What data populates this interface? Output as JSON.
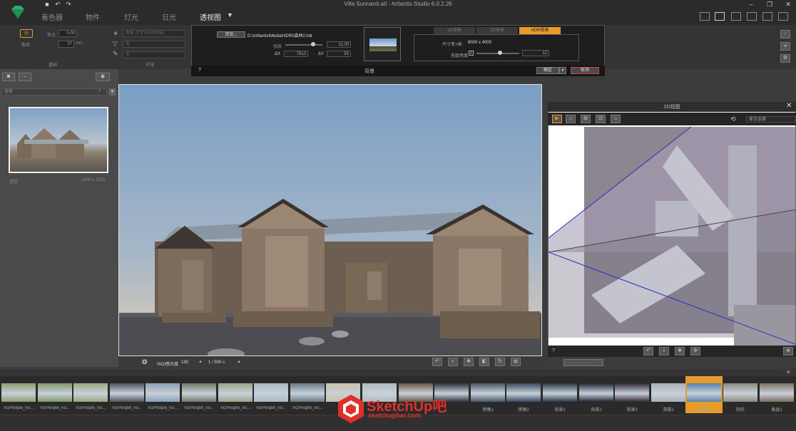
{
  "window": {
    "title": "Villa Sunnanö.atl - Artlantis Studio 6.0.2.26"
  },
  "menu": {
    "tabs": [
      "着色器",
      "物件",
      "灯光",
      "日光",
      "透视图"
    ],
    "active_index": 4,
    "dropdown_icon": "chevron-down-icon"
  },
  "left_panel": {
    "label_light": "焦点",
    "value_light": "0.00",
    "label_lens": "焦距",
    "value_lens": "37",
    "unit_lens": "mm",
    "section_label": "基础"
  },
  "environment_panel": {
    "bg_option": "背景 文字(HDR背景)",
    "option2": "无",
    "option3": "无",
    "section_label": "环境"
  },
  "dialog": {
    "browse_label": "浏览...",
    "path": "D:\\Artlantis\\Media\\HDRI\\森林2.hdr",
    "intensity_label": "强度",
    "intensity_value": "11.00",
    "dx_label": "ΔX",
    "dx_value": "7912",
    "dy_label": "ΔY",
    "dy_value": "55",
    "tabs": [
      "2D背景",
      "3D背景",
      "HDR背景"
    ],
    "active_tab": 2,
    "size_label": "尺寸宽×高:",
    "size_value": "8000 x 4000",
    "blur_label": "无级亮度",
    "blur_value": "12",
    "title": "背景",
    "help": "?",
    "ok_label": "确定",
    "cancel_label": "取消"
  },
  "sidebar": {
    "search_placeholder": "搜索",
    "thumb_caption": "1600 x 1200",
    "thumb_name": "透视"
  },
  "viewport_bar": {
    "iso_label": "ISO/感光度",
    "iso_value": "130",
    "shutter_value": "1 / 500 s"
  },
  "view2d": {
    "title": "2D视图",
    "mode_label": "显示全部",
    "help": "?"
  },
  "filmstrip": {
    "items": [
      {
        "label": "VizPeople_no...",
        "color": "#8aa070"
      },
      {
        "label": "VizPeople_no...",
        "color": "#7f9a6b"
      },
      {
        "label": "VizPeople_no...",
        "color": "#96aa80"
      },
      {
        "label": "VizPeople_no...",
        "color": "#4a5560"
      },
      {
        "label": "VizPeople_no...",
        "color": "#8aa0b8"
      },
      {
        "label": "VizPeople_no...",
        "color": "#707868"
      },
      {
        "label": "VizPeople_no...",
        "color": "#9aa688"
      },
      {
        "label": "VizPeople_no...",
        "color": "#a8b8c8"
      },
      {
        "label": "VizPeople_no...",
        "color": "#6a7a88"
      },
      {
        "label": "",
        "color": "#c8c0a8"
      },
      {
        "label": "",
        "color": "#b0b8c0"
      },
      {
        "label": "",
        "color": "#6a5448"
      },
      {
        "label": "",
        "color": "#2a3440"
      },
      {
        "label": "傍晚1",
        "color": "#485868"
      },
      {
        "label": "傍晚2",
        "color": "#3a4860"
      },
      {
        "label": "夜景1",
        "color": "#283848"
      },
      {
        "label": "夜景2",
        "color": "#1e2a3a"
      },
      {
        "label": "夜景3",
        "color": "#302838"
      },
      {
        "label": "清晨1",
        "color": "#a8b0b8"
      },
      {
        "label": "清晨2",
        "color": "#5a80a8"
      },
      {
        "label": "阴天",
        "color": "#8a8a80"
      },
      {
        "label": "黄昏1",
        "color": "#7a7060"
      }
    ],
    "selected_index": 19
  },
  "watermark": {
    "brand": "SketchUp吧",
    "url": "sketchupbar.com"
  },
  "colors": {
    "accent": "#e89a2a",
    "sky": "#7ea3c4"
  }
}
